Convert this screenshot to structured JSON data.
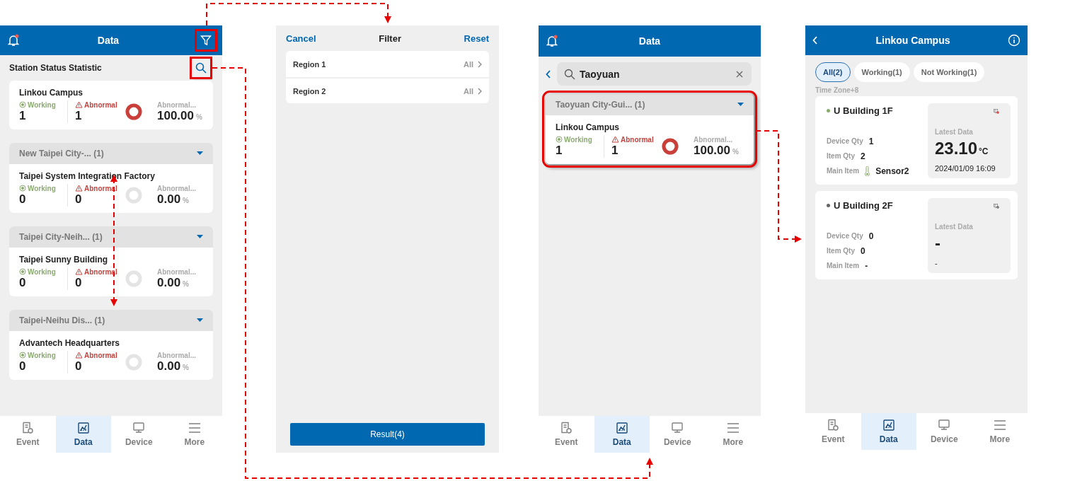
{
  "screens": [
    {
      "kind": "station_list",
      "header": {
        "title": "Data",
        "badge": true,
        "filter_highlighted": true
      },
      "section_title": "Station Status Statistic",
      "search_highlighted": true,
      "groups": [
        {
          "stations": [
            {
              "name": "Linkou Campus",
              "working_label": "Working",
              "working": "1",
              "abnormal_label": "Abnormal",
              "abnormal": "1",
              "rate_label": "Abnormal...",
              "rate": "100.00",
              "unit": "%",
              "level": 1
            }
          ]
        },
        {
          "title": "New Taipei City-... (1)",
          "stations": [
            {
              "name": "Taipei System Integration Factory",
              "working_label": "Working",
              "working": "0",
              "abnormal_label": "Abnormal",
              "abnormal": "0",
              "rate_label": "Abnormal...",
              "rate": "0.00",
              "unit": "%",
              "level": 0
            }
          ]
        },
        {
          "title": "Taipei City-Neih... (1)",
          "stations": [
            {
              "name": "Taipei Sunny Building",
              "working_label": "Working",
              "working": "0",
              "abnormal_label": "Abnormal",
              "abnormal": "0",
              "rate_label": "Abnormal...",
              "rate": "0.00",
              "unit": "%",
              "level": 0
            }
          ]
        },
        {
          "title": "Taipei-Neihu Dis... (1)",
          "stations": [
            {
              "name": "Advantech Headquarters",
              "working_label": "Working",
              "working": "0",
              "abnormal_label": "Abnormal",
              "abnormal": "0",
              "rate_label": "Abnormal...",
              "rate": "0.00",
              "unit": "%",
              "level": 0
            }
          ]
        }
      ],
      "tabs": [
        {
          "kind": "event",
          "label": "Event",
          "selected": false
        },
        {
          "kind": "data",
          "label": "Data",
          "selected": true
        },
        {
          "kind": "device",
          "label": "Device",
          "selected": false
        },
        {
          "kind": "more",
          "label": "More",
          "selected": false
        }
      ]
    },
    {
      "kind": "filter",
      "cancel": "Cancel",
      "title": "Filter",
      "reset": "Reset",
      "rows": [
        {
          "label": "Region 1",
          "value": "All"
        },
        {
          "label": "Region 2",
          "value": "All"
        }
      ],
      "button": "Result(4)"
    },
    {
      "kind": "search",
      "header": {
        "title": "Data",
        "badge": true
      },
      "search": {
        "value": "Taoyuan"
      },
      "groups": [
        {
          "title": "Taoyuan City-Gui... (1)",
          "highlighted": true,
          "stations": [
            {
              "name": "Linkou Campus",
              "working_label": "Working",
              "working": "1",
              "abnormal_label": "Abnormal",
              "abnormal": "1",
              "rate_label": "Abnormal...",
              "rate": "100.00",
              "unit": "%",
              "level": 1
            }
          ]
        }
      ],
      "tabs": [
        {
          "kind": "event",
          "label": "Event",
          "selected": false
        },
        {
          "kind": "data",
          "label": "Data",
          "selected": true
        },
        {
          "kind": "device",
          "label": "Device",
          "selected": false
        },
        {
          "kind": "more",
          "label": "More",
          "selected": false
        }
      ]
    },
    {
      "kind": "detail",
      "header": {
        "title": "Linkou Campus"
      },
      "chips": [
        {
          "label": "All(2)",
          "selected": true
        },
        {
          "label": "Working(1)",
          "selected": false
        },
        {
          "label": "Not Working(1)",
          "selected": false
        }
      ],
      "timezone": "Time Zone+8",
      "buildings": [
        {
          "name": "U Building 1F",
          "color": "#8aab6e",
          "device_qty_label": "Device Qty",
          "device_qty": "1",
          "item_qty_label": "Item Qty",
          "item_qty": "2",
          "main_item_label": "Main Item",
          "main_item": "Sensor2",
          "thermometer": true,
          "latest_label": "Latest Data",
          "value": "23.10",
          "unit": "°C",
          "time": "2024/01/09 16:09",
          "alert": true
        },
        {
          "name": "U Building 2F",
          "color": "#666666",
          "device_qty_label": "Device Qty",
          "device_qty": "0",
          "item_qty_label": "Item Qty",
          "item_qty": "0",
          "main_item_label": "Main Item",
          "main_item": "-",
          "thermometer": false,
          "latest_label": "Latest Data",
          "value": "-",
          "time": "-",
          "alert": false
        }
      ],
      "tabs": [
        {
          "kind": "event",
          "label": "Event",
          "selected": false
        },
        {
          "kind": "data",
          "label": "Data",
          "selected": true
        },
        {
          "kind": "device",
          "label": "Device",
          "selected": false
        },
        {
          "kind": "more",
          "label": "More",
          "selected": false
        }
      ]
    }
  ]
}
